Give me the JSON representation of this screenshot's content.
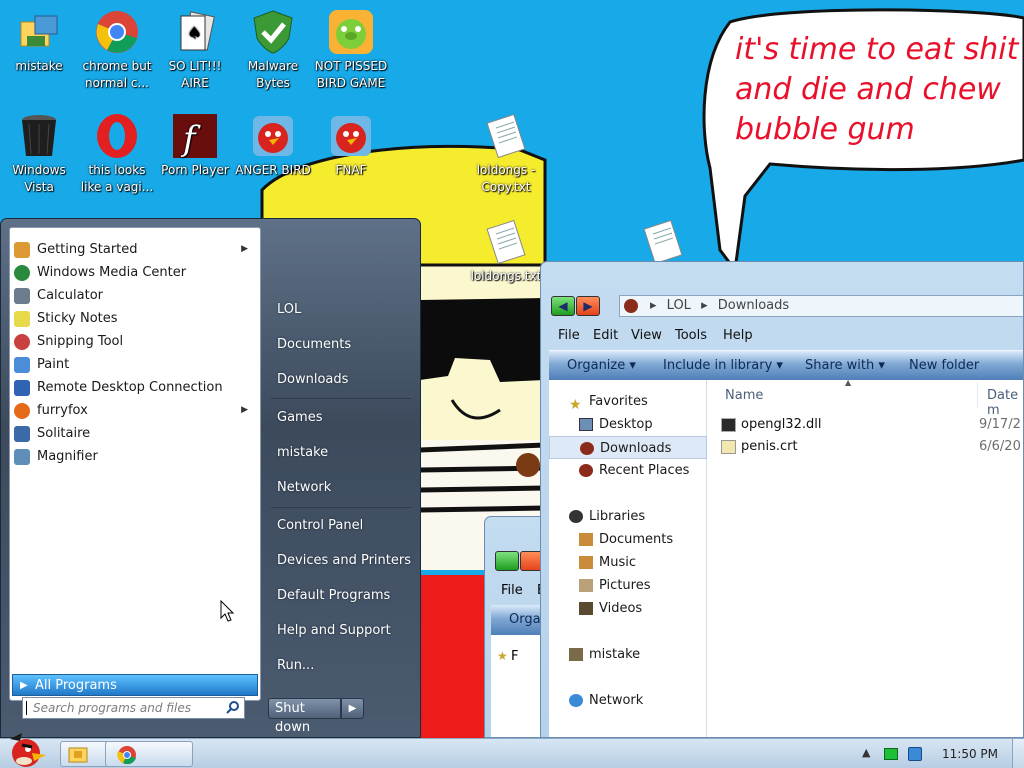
{
  "desktop": {
    "wallpaper_text": "it's time to eat shit and die and chew bubble gum",
    "wallpaper_lines": [
      "it's time to eat shit",
      "and die and chew",
      "bubble gum"
    ],
    "icons": [
      {
        "name": "mistake-icon",
        "label": "mistake",
        "icon": "folder-computer-icon"
      },
      {
        "name": "chrome-icon",
        "label": "chrome but normal c...",
        "icon": "chrome-icon"
      },
      {
        "name": "solitaire-icon",
        "label": "SO LIT!!! AIRE",
        "icon": "playing-cards-icon"
      },
      {
        "name": "malwarebytes-icon",
        "label": "Malware Bytes",
        "icon": "shield-icon"
      },
      {
        "name": "bad-piggies-icon",
        "label": "NOT PISSED BIRD GAME",
        "icon": "green-pig-icon"
      },
      {
        "name": "recycle-bin-icon",
        "label": "Windows Vista",
        "icon": "trash-bin-icon"
      },
      {
        "name": "opera-icon",
        "label": "this looks like a vagi...",
        "icon": "opera-icon"
      },
      {
        "name": "flash-player-icon",
        "label": "Porn Player",
        "icon": "flash-icon"
      },
      {
        "name": "angry-bird-icon",
        "label": "ANGER BIRD",
        "icon": "red-bird-icon"
      },
      {
        "name": "fnaf-icon",
        "label": "FNAF",
        "icon": "red-bird-icon"
      },
      {
        "name": "loldongs-copy-icon",
        "label": "loldongs - Copy.txt",
        "icon": "text-file-icon"
      },
      {
        "name": "loldongs-icon",
        "label": "loldongs.txt",
        "icon": "text-file-icon"
      }
    ]
  },
  "start_menu": {
    "programs": [
      {
        "label": "Getting Started",
        "has_arrow": true,
        "color": "#d93"
      },
      {
        "label": "Windows Media Center",
        "has_arrow": false,
        "color": "#2a8a3c"
      },
      {
        "label": "Calculator",
        "has_arrow": false,
        "color": "#6a7c8e"
      },
      {
        "label": "Sticky Notes",
        "has_arrow": false,
        "color": "#e8d94a"
      },
      {
        "label": "Snipping Tool",
        "has_arrow": false,
        "color": "#c94040"
      },
      {
        "label": "Paint",
        "has_arrow": false,
        "color": "#4a8ed9"
      },
      {
        "label": "Remote Desktop Connection",
        "has_arrow": false,
        "color": "#2f64b5"
      },
      {
        "label": "furryfox",
        "has_arrow": true,
        "color": "#e56a1a"
      },
      {
        "label": "Solitaire",
        "has_arrow": false,
        "color": "#3a6aa8"
      },
      {
        "label": "Magnifier",
        "has_arrow": false,
        "color": "#5f8fb8"
      }
    ],
    "all_programs": "All Programs",
    "search_placeholder": "Search programs and files",
    "right_items": [
      "LOL",
      "Documents",
      "Downloads",
      "Games",
      "mistake",
      "Network",
      "Control Panel",
      "Devices and Printers",
      "Default Programs",
      "Help and Support",
      "Run..."
    ],
    "shutdown_label": "Shut down"
  },
  "explorer": {
    "address_parts": [
      "LOL",
      "Downloads"
    ],
    "menu": [
      "File",
      "Edit",
      "View",
      "Tools",
      "Help"
    ],
    "commands": [
      "Organize",
      "Include in library",
      "Share with",
      "New folder"
    ],
    "nav": {
      "favorites_label": "Favorites",
      "favorites": [
        "Desktop",
        "Downloads",
        "Recent Places"
      ],
      "libraries_label": "Libraries",
      "libraries": [
        "Documents",
        "Music",
        "Pictures",
        "Videos"
      ],
      "homegroup": "mistake",
      "network": "Network"
    },
    "columns": {
      "name": "Name",
      "date": "Date m"
    },
    "files": [
      {
        "name": "opengl32.dll",
        "date": "9/17/2",
        "icon": "dll-file-icon"
      },
      {
        "name": "penis.crt",
        "date": "6/6/20",
        "icon": "certificate-icon"
      }
    ]
  },
  "explorer_behind": {
    "menu_first": "File",
    "menu_second": "E",
    "command_partial": "Orga",
    "nav_partial": "F"
  },
  "taskbar": {
    "clock": "11:50 PM",
    "buttons": [
      "explorer-taskbar-button",
      "chrome-taskbar-button"
    ]
  }
}
